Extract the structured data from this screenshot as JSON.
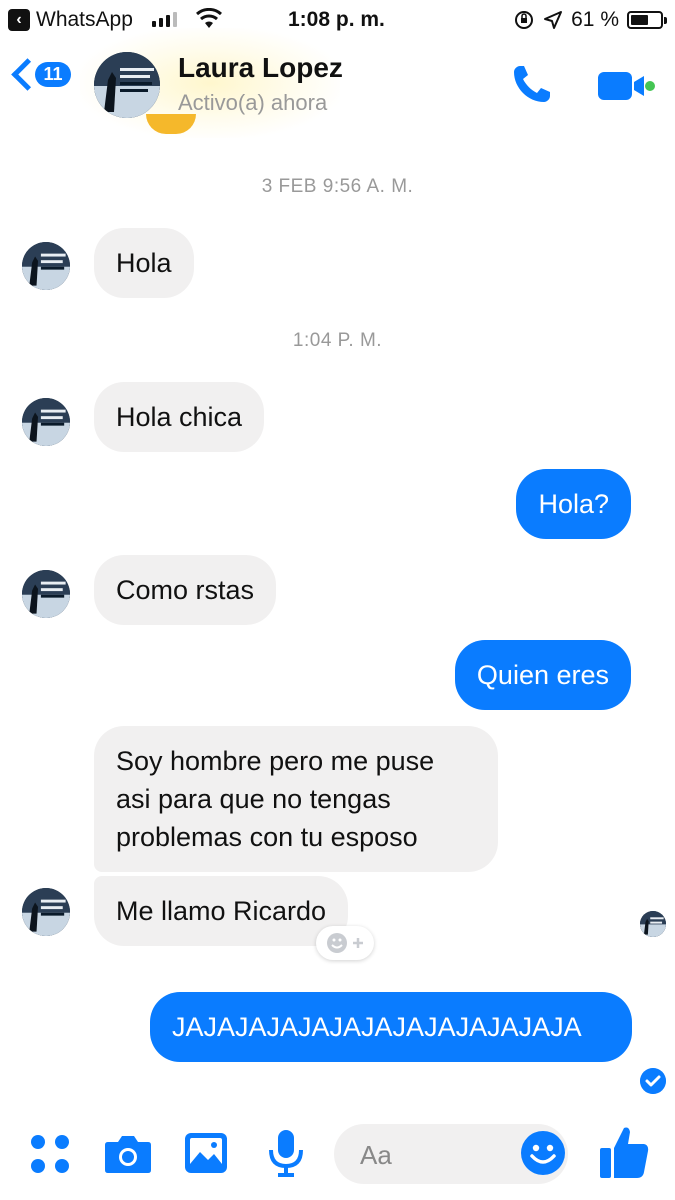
{
  "status_bar": {
    "back_app": "WhatsApp",
    "time": "1:08 p. m.",
    "battery_percent": "61 %",
    "battery_level": 0.61
  },
  "header": {
    "back_badge": "11",
    "contact_name": "Laura Lopez",
    "status": "Activo(a) ahora",
    "accent_color": "#0a7cff",
    "online_color": "#44c553"
  },
  "messages": [
    {
      "type": "timestamp",
      "text": "3 FEB 9:56 A. M."
    },
    {
      "type": "incoming",
      "text": "Hola"
    },
    {
      "type": "timestamp",
      "text": "1:04 P. M."
    },
    {
      "type": "incoming",
      "text": "Hola chica"
    },
    {
      "type": "outgoing",
      "text": "Hola?"
    },
    {
      "type": "incoming",
      "text": "Como rstas"
    },
    {
      "type": "outgoing",
      "text": "Quien eres"
    },
    {
      "type": "incoming",
      "text": "Soy hombre pero me puse asi para que no tengas problemas con tu esposo"
    },
    {
      "type": "incoming",
      "text": "Me llamo Ricardo"
    },
    {
      "type": "outgoing",
      "text": "JAJAJAJAJAJAJAJAJAJAJAJAJA"
    }
  ],
  "reaction_icon": "add-reaction-icon",
  "composer": {
    "placeholder": "Aa",
    "icons": [
      "more-dots-icon",
      "camera-icon",
      "gallery-icon",
      "microphone-icon",
      "emoji-icon",
      "thumbs-up-icon"
    ]
  }
}
